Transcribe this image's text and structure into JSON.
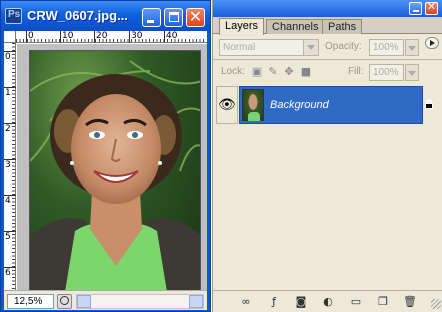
{
  "document": {
    "title": "CRW_0607.jpg...",
    "zoom": "12,5%",
    "ruler_h": [
      "0",
      "10",
      "20",
      "30",
      "40"
    ],
    "ruler_v": [
      "0",
      "1",
      "2",
      "3",
      "4",
      "5",
      "6"
    ]
  },
  "layers_panel": {
    "tabs": [
      "Layers",
      "Channels",
      "Paths"
    ],
    "active_tab": "Layers",
    "blend_mode": "Normal",
    "opacity_label": "Opacity:",
    "opacity_value": "100%",
    "lock_label": "Lock:",
    "fill_label": "Fill:",
    "fill_value": "100%",
    "layers": [
      {
        "name": "Background",
        "visible": true,
        "locked": true,
        "selected": true
      }
    ]
  },
  "colors": {
    "titlebar": "#0a4dcf",
    "close_button": "#d9431d",
    "selected_layer": "#316ac5",
    "panel_bg": "#ece9d8"
  },
  "icons": {
    "doc_app": "photoshop-doc-icon",
    "layer_visibility": "eye-icon",
    "lock_transparent": "lock-transparent-icon",
    "lock_paint": "brush-icon",
    "lock_position": "move-icon",
    "lock_all": "lock-icon",
    "bottom_bar": [
      "link-icon",
      "layer-style-icon",
      "mask-icon",
      "adjustment-layer-icon",
      "folder-icon",
      "new-layer-icon",
      "trash-icon"
    ]
  }
}
